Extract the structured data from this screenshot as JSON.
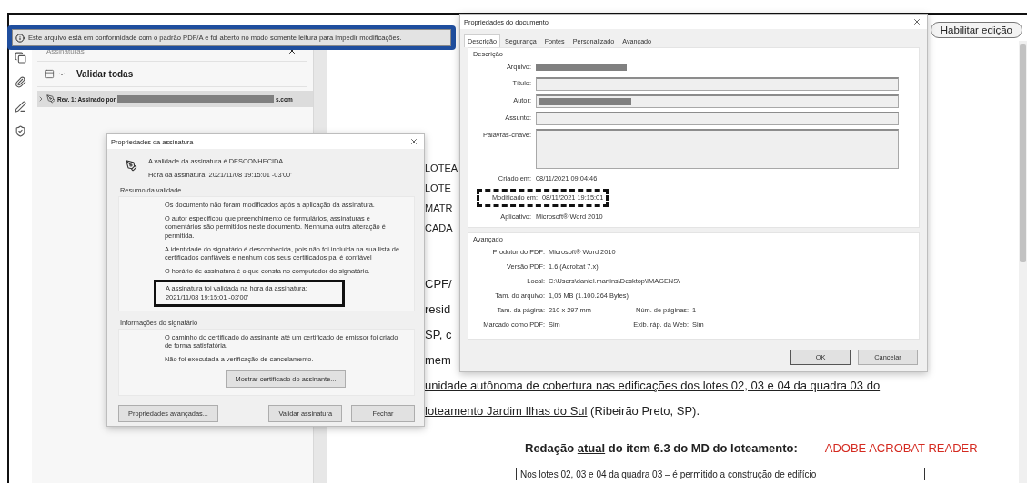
{
  "banner": {
    "text": "Este arquivo está em conformidade com o padrão PDF/A e foi aberto no modo somente leitura para impedir modificações."
  },
  "toolbar": {
    "button": "Habilitar edição"
  },
  "signatures_panel": {
    "title": "Assinaturas",
    "validate_all": "Validar todas",
    "items": [
      {
        "label": "Rev. 1: Assinado por",
        "suffix": "s.com",
        "redacted": true,
        "expanded": false,
        "selected": true
      }
    ]
  },
  "document": {
    "caps_lines": [
      "LOTEA",
      "LOTE",
      "MATR",
      "CADA"
    ],
    "fragment_lines": [
      "CPF/",
      "resid",
      "SP, c",
      "mem"
    ],
    "paragraph_lines": [
      {
        "segments": [
          {
            "text": "unidade autônoma de cobertura nas edificações dos lotes 02, 03 e 04 da quadra 03 do",
            "underlined": true
          }
        ]
      },
      {
        "segments": [
          {
            "text": "loteamento Jardim Ilhas do Sul",
            "underlined": true
          },
          {
            "text": " (Ribeirão Preto, SP).",
            "underlined": false
          }
        ]
      }
    ],
    "heading": {
      "segments": [
        {
          "text": "Redação ",
          "underlined": false
        },
        {
          "text": "atual",
          "underlined": true
        },
        {
          "text": " do item 6.3 do MD do loteamento:",
          "underlined": false
        }
      ]
    },
    "note": {
      "text": "ADOBE ACROBAT READER",
      "color": "#d42a20"
    },
    "quote": "Nos lotes 02, 03 e 04 da quadra 03 – é permitido a construção de edifício"
  },
  "signature_dialog": {
    "title": "Propriedades da assinatura",
    "status": "A validade da assinatura é DESCONHECIDA.",
    "time": "Hora da assinatura: 2021/11/08 19:15:01 -03'00'",
    "summary": {
      "title": "Resumo da validade",
      "items": [
        {
          "text": "Os documento não foram modificados após a aplicação da assinatura.",
          "highlighted": false
        },
        {
          "text": "O autor especificou que preenchimento de formulários, assinaturas e comentários são permitidos neste documento. Nenhuma outra alteração é permitida.",
          "highlighted": false
        },
        {
          "text": "A identidade do signatário é desconhecida, pois não foi incluída na sua lista de certificados confiáveis e nenhum dos seus certificados pai é confiável",
          "highlighted": false
        },
        {
          "text": "O horário de assinatura é o que consta no computador do signatário.",
          "highlighted": false
        },
        {
          "text": "A assinatura foi validada na hora da assinatura:\n2021/11/08 19:15:01 -03'00'",
          "highlighted": true
        }
      ]
    },
    "signer": {
      "title": "Informações do signatário",
      "items": [
        "O caminho do certificado do assinante até um certificado de emissor foi criado de forma satisfatória.",
        "Não foi executada a verificação de cancelamento."
      ],
      "button": "Mostrar certificado do assinante..."
    },
    "buttons": [
      "Propriedades avançadas...",
      "Validar assinatura",
      "Fechar"
    ]
  },
  "document_properties": {
    "title": "Propriedades do documento",
    "tabs": [
      {
        "label": "Descrição",
        "selected": true
      },
      {
        "label": "Segurança",
        "selected": false
      },
      {
        "label": "Fontes",
        "selected": false
      },
      {
        "label": "Personalizado",
        "selected": false
      },
      {
        "label": "Avançado",
        "selected": false
      }
    ],
    "description": {
      "title": "Descrição",
      "fields": [
        {
          "kind": "text",
          "label": "Arquivo:",
          "redacted": true,
          "highlighted": false
        },
        {
          "kind": "input",
          "label": "Título:",
          "redacted": false,
          "highlighted": false
        },
        {
          "kind": "input",
          "label": "Autor:",
          "redacted": true,
          "highlighted": false
        },
        {
          "kind": "input",
          "label": "Assunto:",
          "redacted": false,
          "highlighted": false
        },
        {
          "kind": "textarea",
          "label": "Palavras-chave:",
          "redacted": false,
          "highlighted": false
        },
        {
          "kind": "text",
          "label": "Criado em:",
          "value": "08/11/2021 09:04:46",
          "redacted": false,
          "highlighted": false
        },
        {
          "kind": "text",
          "label": "Modificado em:",
          "value": "08/11/2021 19:15:01",
          "redacted": false,
          "highlighted": true
        },
        {
          "kind": "text",
          "label": "Aplicativo:",
          "value": "Microsoft® Word 2010",
          "redacted": false,
          "highlighted": false
        }
      ]
    },
    "advanced": {
      "title": "Avançado",
      "rows": [
        [
          {
            "label": "Produtor do PDF:",
            "value": "Microsoft® Word 2010"
          }
        ],
        [
          {
            "label": "Versão PDF:",
            "value": "1.6 (Acrobat 7.x)"
          }
        ],
        [
          {
            "label": "Local:",
            "value": "C:\\Users\\daniel.martins\\Desktop\\IMAGENS\\"
          }
        ],
        [
          {
            "label": "Tam. do arquivo:",
            "value": "1,05 MB (1.100.264 Bytes)"
          }
        ],
        [
          {
            "label": "Tam. da página:",
            "value": "210 x 297 mm"
          },
          {
            "label": "Núm. de páginas:",
            "value": "1"
          }
        ],
        [
          {
            "label": "Marcado como PDF:",
            "value": "Sim"
          },
          {
            "label": "Exib. ráp. da Web:",
            "value": "Sim"
          }
        ]
      ]
    },
    "buttons": [
      "OK",
      "Cancelar"
    ]
  }
}
